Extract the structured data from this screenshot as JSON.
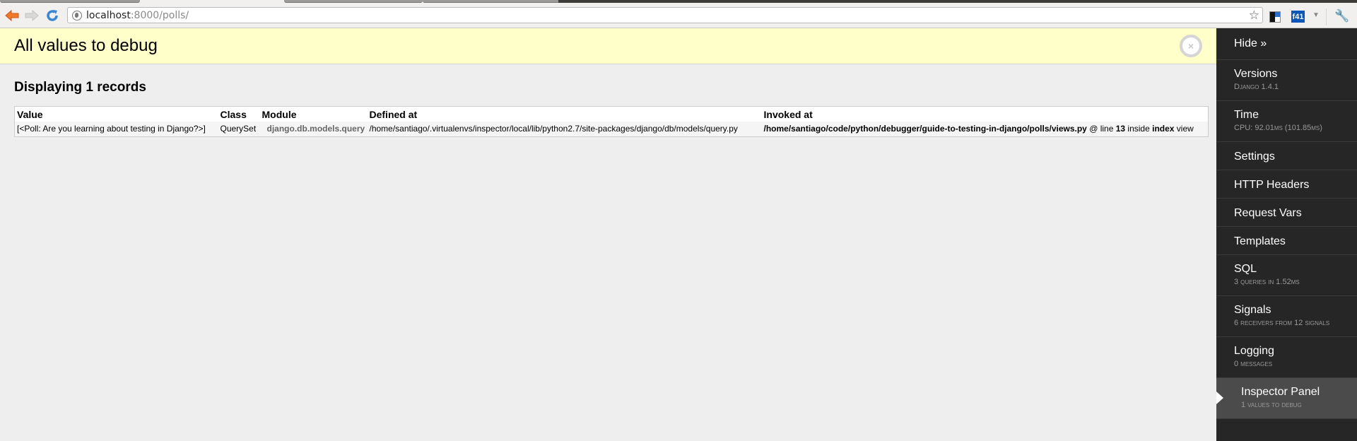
{
  "browser": {
    "url_host": "localhost",
    "url_rest": ":8000/polls/",
    "extension_label": "f41"
  },
  "panel": {
    "title": "All values to debug",
    "close_icon": "×",
    "records_title": "Displaying 1 records",
    "columns": [
      "Value",
      "Class",
      "Module",
      "Defined at",
      "Invoked at"
    ],
    "rows": [
      {
        "value": "[<Poll: Are you learning about testing in Django?>]",
        "class": "QuerySet",
        "module": "django.db.models.query",
        "defined_at": "/home/santiago/.virtualenvs/inspector/local/lib/python2.7/site-packages/django/db/models/query.py",
        "invoked_path": "/home/santiago/code/python/debugger/guide-to-testing-in-django/polls/views.py",
        "invoked_at_text": " @ line ",
        "invoked_line": "13",
        "invoked_inside_text": " inside ",
        "invoked_view": "index",
        "invoked_view_text": " view"
      }
    ]
  },
  "toolbar": {
    "hide_label": "Hide »",
    "items": [
      {
        "label": "Versions",
        "sub": "Django 1.4.1"
      },
      {
        "label": "Time",
        "sub": "CPU: 92.01ms (101.85ms)"
      },
      {
        "label": "Settings"
      },
      {
        "label": "HTTP Headers"
      },
      {
        "label": "Request Vars"
      },
      {
        "label": "Templates"
      },
      {
        "label": "SQL",
        "sub": "3 queries in 1.52ms"
      },
      {
        "label": "Signals",
        "sub": "6 receivers from 12 signals"
      },
      {
        "label": "Logging",
        "sub": "0 messages"
      },
      {
        "label": "Inspector Panel",
        "sub": "1 values to debug",
        "active": true
      }
    ]
  }
}
